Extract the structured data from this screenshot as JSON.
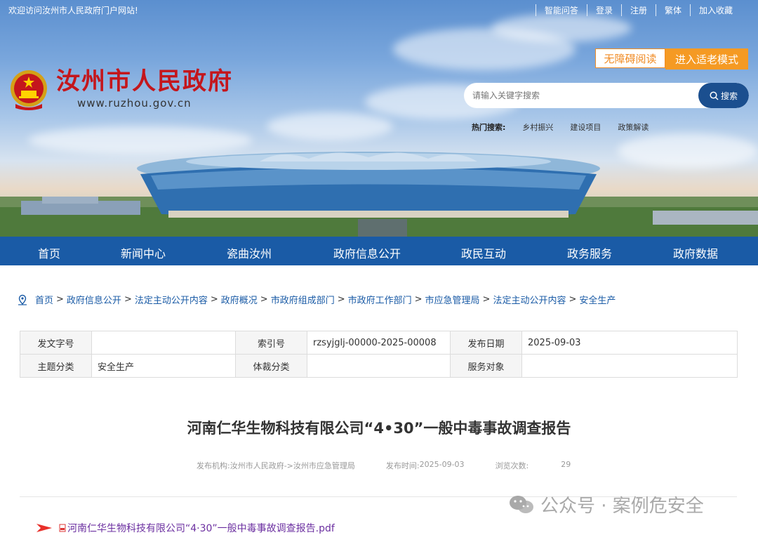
{
  "topbar": {
    "welcome": "欢迎访问汝州市人民政府门户网站!",
    "links": [
      "智能问答",
      "登录",
      "注册",
      "繁体",
      "加入收藏"
    ]
  },
  "site": {
    "name": "汝州市人民政府",
    "url": "www.ruzhou.gov.cn"
  },
  "modes": {
    "accessible": "无障碍阅读",
    "elder": "进入适老模式"
  },
  "search": {
    "placeholder": "请输入关键字搜索",
    "button": "搜索",
    "hot_label": "热门搜索:",
    "hot_words": [
      "乡村振兴",
      "建设项目",
      "政策解读"
    ]
  },
  "nav": [
    "首页",
    "新闻中心",
    "瓷曲汝州",
    "政府信息公开",
    "政民互动",
    "政务服务",
    "政府数据"
  ],
  "breadcrumb": [
    "首页",
    "政府信息公开",
    "法定主动公开内容",
    "政府概况",
    "市政府组成部门",
    "市政府工作部门",
    "市应急管理局",
    "法定主动公开内容",
    "安全生产"
  ],
  "meta": {
    "row1": {
      "doc_no_label": "发文字号",
      "doc_no": "",
      "index_label": "索引号",
      "index": "rzsyjglj-00000-2025-00008",
      "date_label": "发布日期",
      "date": "2025-09-03"
    },
    "row2": {
      "topic_label": "主题分类",
      "topic": "安全生产",
      "genre_label": "体裁分类",
      "genre": "",
      "audience_label": "服务对象",
      "audience": ""
    }
  },
  "article": {
    "title": "河南仁华生物科技有限公司“4•30”一般中毒事故调查报告",
    "publisher_label": "发布机构:",
    "publisher": "汝州市人民政府->汝州市应急管理局",
    "time_label": "发布时间:",
    "time": "2025-09-03",
    "views_label": "浏览次数:",
    "views": "29",
    "attachment": "河南仁华生物科技有限公司“4·30”一般中毒事故调查报告.pdf"
  },
  "watermark": "公众号 · 案例危安全",
  "colors": {
    "nav": "#1a5ba6",
    "brand_red": "#c4161c",
    "orange": "#f59a23",
    "search_btn": "#1b4f8f"
  }
}
